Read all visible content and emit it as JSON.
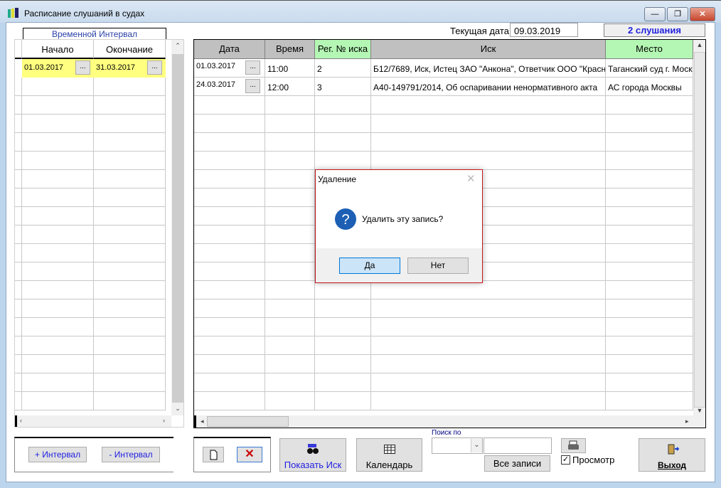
{
  "window": {
    "title": "Расписание слушаний в судах",
    "minimize": "—",
    "restore": "❐",
    "close": "✕"
  },
  "header": {
    "current_date_label": "Текущая дата",
    "current_date_value": "09.03.2019",
    "hearings_count": "2 слушания"
  },
  "interval": {
    "tab_label": "Временной Интервал",
    "columns": [
      "Начало",
      "Окончание"
    ],
    "rows": [
      {
        "start": "01.03.2017",
        "end": "31.03.2017"
      }
    ],
    "dots": "..."
  },
  "hearings": {
    "columns": [
      "Дата",
      "Время",
      "Рег. № иска",
      "Иск",
      "Место"
    ],
    "rows": [
      {
        "date": "01.03.2017",
        "time": "11:00",
        "reg": "2",
        "claim": "Б12/7689, Иск, Истец ЗАО \"Анкона\", Ответчик ООО \"Красн",
        "place": "Таганский суд г. Моск"
      },
      {
        "date": "24.03.2017",
        "time": "12:00",
        "reg": "3",
        "claim": "А40-149791/2014, Об оспаривании ненормативного акта",
        "place": "АС города Москвы"
      }
    ]
  },
  "toolbar": {
    "add_interval": "+ Интервал",
    "remove_interval": "- Интервал",
    "show_claim": "Показать Иск",
    "calendar": "Календарь",
    "search_label": "Поиск по",
    "search_value": "",
    "all_records": "Все записи",
    "preview": "Просмотр",
    "preview_checked": true,
    "exit": "Выход",
    "delete_glyph": "✕"
  },
  "dialog": {
    "title": "Удаление",
    "message": "Удалить эту запись?",
    "yes": "Да",
    "no": "Нет"
  },
  "colors": {
    "accent_blue": "#0000ff",
    "highlight_row": "#ffff80",
    "green_header": "#b4f7b4",
    "dialog_border": "#c4161c"
  }
}
